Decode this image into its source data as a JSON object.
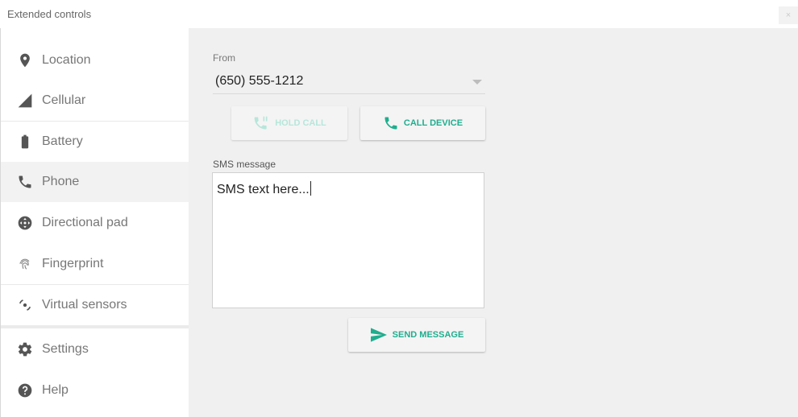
{
  "window": {
    "title": "Extended controls",
    "close": "×"
  },
  "sidebar": {
    "items": [
      {
        "label": "Location",
        "icon": "location-pin-icon"
      },
      {
        "label": "Cellular",
        "icon": "signal-icon"
      },
      {
        "label": "Battery",
        "icon": "battery-icon"
      },
      {
        "label": "Phone",
        "icon": "phone-icon",
        "active": true
      },
      {
        "label": "Directional pad",
        "icon": "dpad-icon"
      },
      {
        "label": "Fingerprint",
        "icon": "fingerprint-icon"
      },
      {
        "label": "Virtual sensors",
        "icon": "rotate-icon"
      },
      {
        "label": "Settings",
        "icon": "gear-icon"
      },
      {
        "label": "Help",
        "icon": "help-icon"
      }
    ]
  },
  "phone": {
    "from_label": "From",
    "from_value": "(650) 555-1212",
    "hold_call": "HOLD CALL",
    "call_device": "CALL DEVICE",
    "sms_label": "SMS message",
    "sms_text": "SMS text here...",
    "send_message": "SEND MESSAGE"
  },
  "colors": {
    "accent": "#1fae8e",
    "accent_disabled": "#b7e6da",
    "icon": "#555555"
  }
}
